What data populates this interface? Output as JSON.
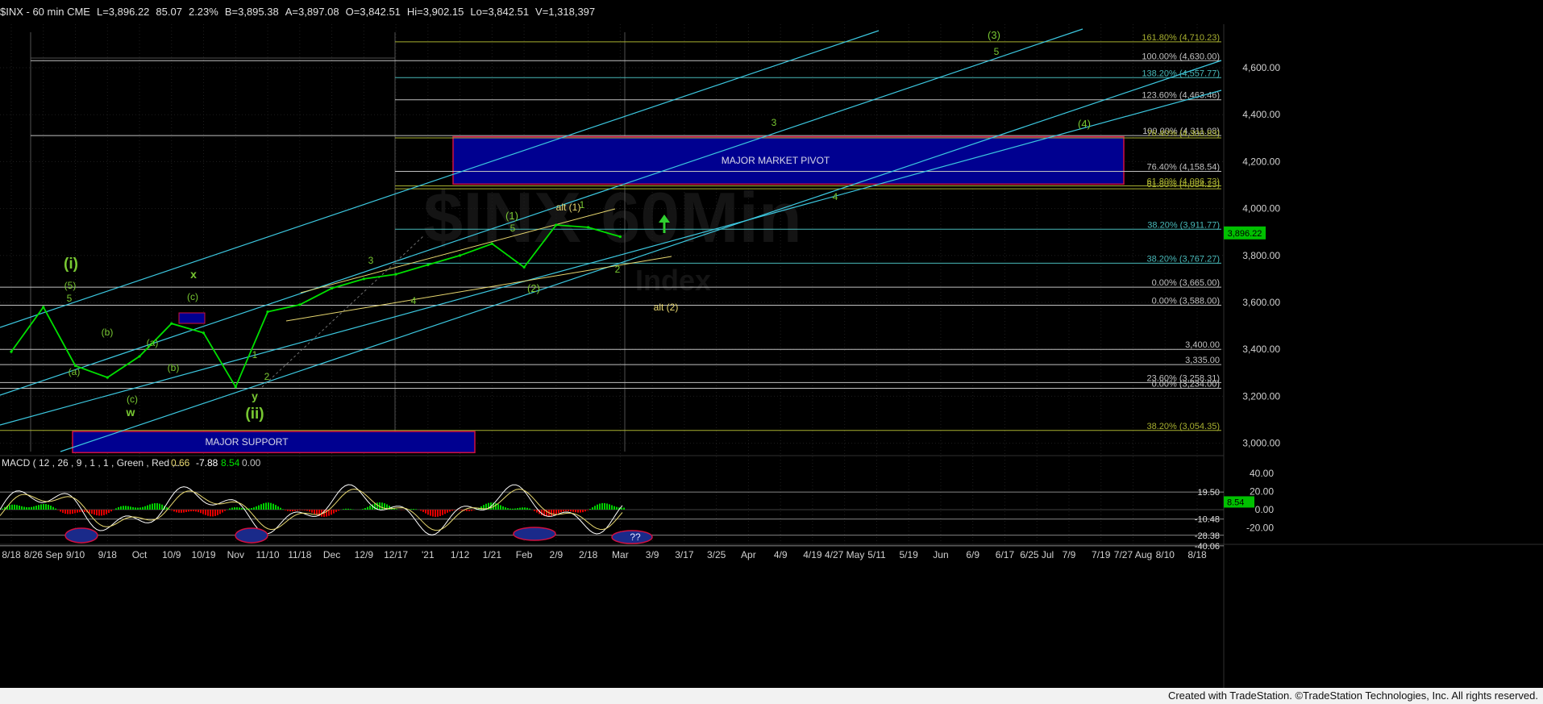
{
  "header": {
    "symbol": "$INX - 60 min  CME",
    "last": "L=3,896.22",
    "change": "85.07",
    "change_pct": "2.23%",
    "bid": "B=3,895.38",
    "ask": "A=3,897.08",
    "open": "O=3,842.51",
    "high": "Hi=3,902.15",
    "low": "Lo=3,842.51",
    "volume": "V=1,318,397"
  },
  "footer": {
    "text": "Created with TradeStation. ©TradeStation Technologies, Inc. All rights reserved."
  },
  "watermark": {
    "line1": "$INX 60Min",
    "line2": "Index"
  },
  "colors": {
    "price": "#00e000",
    "channel": "#3cc8e0",
    "wedge": "#e8d870",
    "wave": "#78c832",
    "alt": "#e8d870",
    "box": "#000090",
    "box_border": "#d01040",
    "fib_teal": "#48b8b8",
    "fib_white": "#c0c0c0",
    "fib_olive": "#a8b030",
    "current_price_bg": "#00c000"
  },
  "chart_data": [
    {
      "type": "line",
      "title": "$INX - 60 min",
      "ylim": [
        2960,
        4780
      ],
      "y_ticks": [
        "3,000.00",
        "3,200.00",
        "3,400.00",
        "3,600.00",
        "3,800.00",
        "4,000.00",
        "4,200.00",
        "4,400.00",
        "4,600.00"
      ],
      "x_ticks": [
        "8/18",
        "8/26 Sep",
        "9/10",
        "9/18",
        "Oct",
        "10/9",
        "10/19",
        "Nov",
        "11/10",
        "11/18",
        "Dec",
        "12/9",
        "12/17",
        "'21",
        "1/12",
        "1/21",
        "Feb",
        "2/9",
        "2/18",
        "Mar",
        "3/9",
        "3/17",
        "3/25",
        "Apr",
        "4/9",
        "4/19",
        "4/27 May",
        "5/11",
        "5/19",
        "Jun",
        "6/9",
        "6/17",
        "6/25 Jul",
        "7/9",
        "7/19",
        "7/27 Aug",
        "8/10",
        "8/18"
      ],
      "current_price": {
        "label": "3,896.22",
        "value": 3896.22
      },
      "series": [
        {
          "x": [
            "8/18",
            "8/26 Sep",
            "9/10",
            "9/18",
            "Oct",
            "10/9",
            "10/19",
            "Nov",
            "11/10",
            "11/18",
            "Dec",
            "12/9",
            "12/17",
            "'21",
            "1/12",
            "1/21",
            "Feb",
            "2/9",
            "2/18",
            "Mar"
          ],
          "values": [
            3390,
            3580,
            3330,
            3280,
            3370,
            3510,
            3470,
            3240,
            3560,
            3590,
            3660,
            3700,
            3720,
            3760,
            3800,
            3850,
            3750,
            3930,
            3920,
            3880
          ]
        }
      ],
      "levels": [
        {
          "label": "161.80% (4,710.23)",
          "value": 4710.23,
          "style": "olive"
        },
        {
          "label": "100.00% (4,630.00)",
          "value": 4630.0,
          "style": "white"
        },
        {
          "label": "138.20% (4,557.77)",
          "value": 4557.77,
          "style": "teal"
        },
        {
          "label": "123.60% (4,463.46)",
          "value": 4463.46,
          "style": "white"
        },
        {
          "label": "100.00% (4,311.08)",
          "value": 4311.08,
          "style": "white"
        },
        {
          "label": "76.40% (4,300.83)",
          "value": 4300.83,
          "style": "olive"
        },
        {
          "label": "76.40% (4,158.54)",
          "value": 4158.54,
          "style": "white"
        },
        {
          "label": "61.80% (4,096.73)",
          "value": 4096.73,
          "style": "olive"
        },
        {
          "label": "61.80% (4,084.23)",
          "value": 4084.23,
          "style": "olive"
        },
        {
          "label": "38.20% (3,911.77)",
          "value": 3911.77,
          "style": "teal"
        },
        {
          "label": "38.20% (3,767.27)",
          "value": 3767.27,
          "style": "teal"
        },
        {
          "label": "0.00% (3,665.00)",
          "value": 3665.0,
          "style": "white"
        },
        {
          "label": "0.00% (3,588.00)",
          "value": 3588.0,
          "style": "white"
        },
        {
          "label": "3,400.00",
          "value": 3400.0,
          "style": "white"
        },
        {
          "label": "3,335.00",
          "value": 3335.0,
          "style": "white"
        },
        {
          "label": "23.60% (3,258.31)",
          "value": 3258.31,
          "style": "white"
        },
        {
          "label": "0.00% (3,234.00)",
          "value": 3234.0,
          "style": "white"
        },
        {
          "label": "38.20% (3,054.35)",
          "value": 3054.35,
          "style": "olive"
        }
      ],
      "zones": [
        {
          "label": "MAJOR MARKET PIVOT",
          "from": 4104,
          "to": 4306
        },
        {
          "label": "MAJOR SUPPORT",
          "from": 2960,
          "to": 3050
        }
      ],
      "wave_labels": [
        "(3)",
        "5",
        "3",
        "(4)",
        "4",
        "(1)",
        "5",
        "3",
        "4",
        "(2)",
        "2",
        "1",
        "(i)",
        "(5)",
        "5",
        "x",
        "(c)",
        "(b)",
        "(a)",
        "(a)",
        "(b)",
        "(c)",
        "w",
        "1",
        "2",
        "y",
        "(ii)"
      ],
      "alt_labels": [
        "alt (1)",
        "alt (2)"
      ]
    },
    {
      "type": "line",
      "title": "MACD ( 12 , 26 , 9 , 1 , 1 , Green , Red ,...",
      "readout": [
        "0.66",
        "-7.88",
        "8.54",
        "0.00"
      ],
      "y_ticks": [
        "40.00",
        "20.00",
        "0.00",
        "-20.00"
      ],
      "levels": [
        {
          "label": "19.50",
          "value": 19.5
        },
        {
          "label": "-10.48",
          "value": -10.48
        },
        {
          "label": "-28.38",
          "value": -28.38
        },
        {
          "label": "-40.06",
          "value": -40.06
        }
      ],
      "current_value": {
        "label": "8.54",
        "value": 8.54
      },
      "annotation": "??"
    }
  ]
}
